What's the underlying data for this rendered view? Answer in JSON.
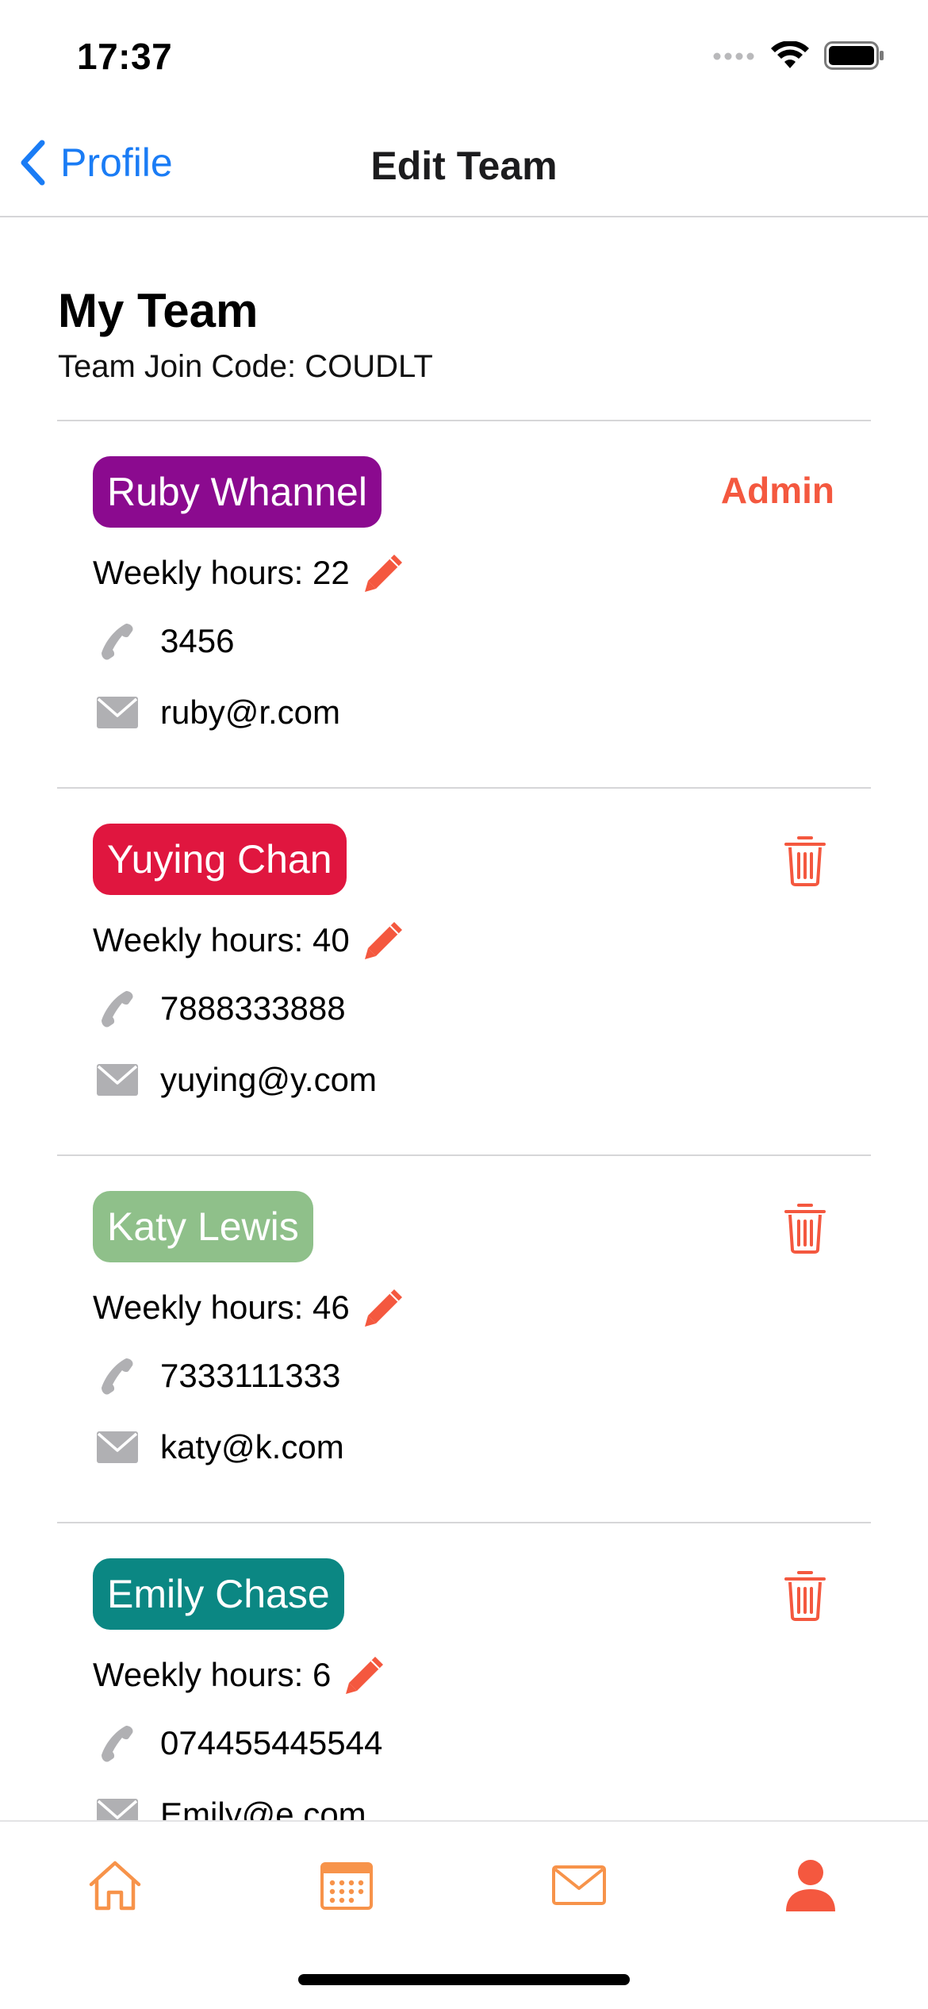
{
  "status_bar": {
    "time": "17:37"
  },
  "nav": {
    "back_label": "Profile",
    "title": "Edit Team"
  },
  "team": {
    "title": "My Team",
    "join_code": "Team Join Code: COUDLT"
  },
  "members": [
    {
      "name": "Ruby Whannel",
      "chip_color": "#8b0a8f",
      "role": "Admin",
      "hours": "Weekly hours: 22",
      "phone": "3456",
      "email": "ruby@r.com"
    },
    {
      "name": "Yuying Chan",
      "chip_color": "#e0163f",
      "hours": "Weekly hours: 40",
      "phone": "7888333888",
      "email": "yuying@y.com"
    },
    {
      "name": "Katy Lewis",
      "chip_color": "#8fc08a",
      "hours": "Weekly hours: 46",
      "phone": "7333111333",
      "email": "katy@k.com"
    },
    {
      "name": "Emily Chase",
      "chip_color": "#0b8783",
      "hours": "Weekly hours: 6",
      "phone": "074455445544",
      "email": "Emily@e.com"
    }
  ],
  "tabs": [
    {
      "icon": "home-icon",
      "active": false
    },
    {
      "icon": "calendar-icon",
      "active": false
    },
    {
      "icon": "mail-icon",
      "active": false
    },
    {
      "icon": "person-icon",
      "active": true
    }
  ],
  "colors": {
    "accent": "#f4583f",
    "link": "#1a7cf5",
    "tab_inactive": "#f7934a",
    "icon_gray": "#b0b0b3"
  }
}
